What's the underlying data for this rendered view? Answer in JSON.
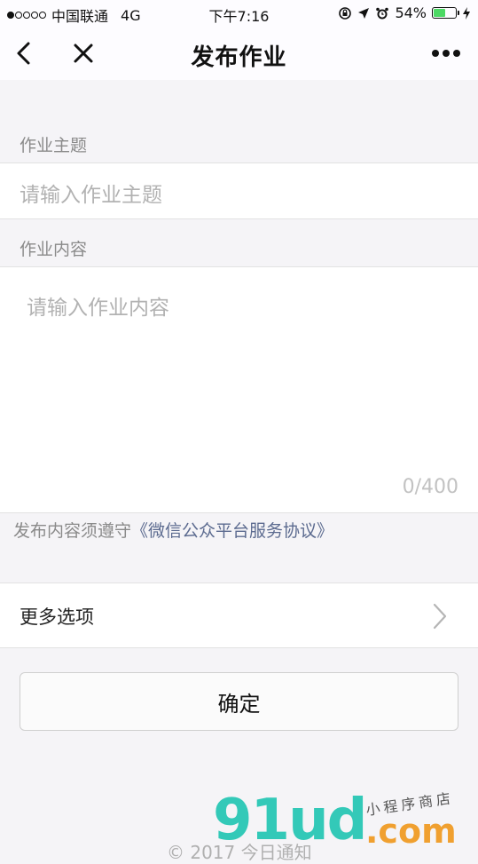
{
  "status_bar": {
    "carrier": "中国联通",
    "network": "4G",
    "time": "下午7:16",
    "battery_percent": "54%",
    "battery_level": 0.54,
    "icons": [
      "signal-dots",
      "rotation-lock-icon",
      "location-arrow-icon",
      "alarm-icon",
      "battery-icon",
      "charging-icon"
    ]
  },
  "nav": {
    "title": "发布作业",
    "back_icon": "chevron-left-icon",
    "close_icon": "close-icon",
    "more_icon": "more-dots-icon"
  },
  "form": {
    "subject_label": "作业主题",
    "subject_placeholder": "请输入作业主题",
    "content_label": "作业内容",
    "content_placeholder": "请输入作业内容",
    "content_counter": "0/400"
  },
  "agreement": {
    "prefix": "发布内容须遵守",
    "link": "《微信公众平台服务协议》"
  },
  "more_options": {
    "label": "更多选项",
    "arrow_icon": "chevron-right-icon"
  },
  "confirm_label": "确定",
  "watermark": {
    "logo": "91ud",
    "domain": ".com",
    "tagline": "小程序商店"
  },
  "footer": {
    "copyright": "© 2017 今日通知"
  },
  "colors": {
    "background": "#f5f4f7",
    "placeholder": "#b2b2b2",
    "link": "#5b6a8f",
    "battery": "#4cd964",
    "watermark_green": "#33c9b8",
    "watermark_orange": "#f0a030"
  }
}
